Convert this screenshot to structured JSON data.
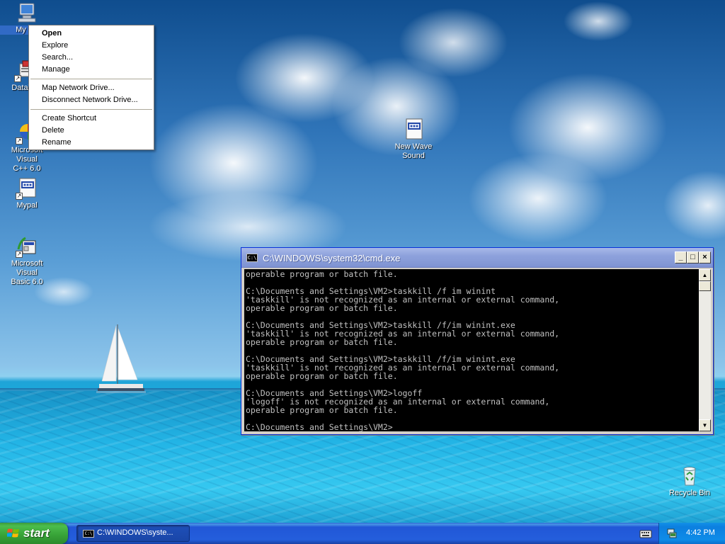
{
  "desktop": {
    "icons": [
      {
        "label": "My Co",
        "icon": "my-computer-icon"
      },
      {
        "label": "DataWa",
        "icon": "datawarehouse-icon"
      },
      {
        "label": "Microsoft Visual\nC++ 6.0",
        "icon": "visual-cpp-icon"
      },
      {
        "label": "Mypal",
        "icon": "mypal-icon"
      },
      {
        "label": "Microsoft Visual\nBasic 6.0",
        "icon": "visual-basic-icon"
      },
      {
        "label": "New Wave\nSound",
        "icon": "wave-file-icon"
      },
      {
        "label": "Recycle Bin",
        "icon": "recycle-bin-icon"
      }
    ]
  },
  "context_menu": {
    "items": [
      {
        "label": "Open",
        "bold": true
      },
      {
        "label": "Explore"
      },
      {
        "label": "Search..."
      },
      {
        "label": "Manage"
      },
      {
        "separator": true
      },
      {
        "label": "Map Network Drive..."
      },
      {
        "label": "Disconnect Network Drive..."
      },
      {
        "separator": true
      },
      {
        "label": "Create Shortcut"
      },
      {
        "label": "Delete"
      },
      {
        "label": "Rename"
      }
    ]
  },
  "cmd_window": {
    "title": "C:\\WINDOWS\\system32\\cmd.exe",
    "icon_text": "C:\\",
    "minimize": "_",
    "maximize": "□",
    "close": "×",
    "lines": [
      "operable program or batch file.",
      "",
      "C:\\Documents and Settings\\VM2>taskkill /f im winint",
      "'taskkill' is not recognized as an internal or external command,",
      "operable program or batch file.",
      "",
      "C:\\Documents and Settings\\VM2>taskkill /f/im winint.exe",
      "'taskkill' is not recognized as an internal or external command,",
      "operable program or batch file.",
      "",
      "C:\\Documents and Settings\\VM2>taskkill /f/im winint.exe",
      "'taskkill' is not recognized as an internal or external command,",
      "operable program or batch file.",
      "",
      "C:\\Documents and Settings\\VM2>logoff",
      "'logoff' is not recognized as an internal or external command,",
      "operable program or batch file.",
      "",
      "C:\\Documents and Settings\\VM2>"
    ]
  },
  "taskbar": {
    "start_label": "start",
    "task_button_label": "C:\\WINDOWS\\syste...",
    "task_icon_text": "C:\\",
    "clock": "4:42 PM"
  },
  "colors": {
    "taskbar_blue": "#245edc",
    "start_green": "#37a237",
    "tray_blue": "#0e8ce8",
    "console_text": "#c0c0c0"
  }
}
